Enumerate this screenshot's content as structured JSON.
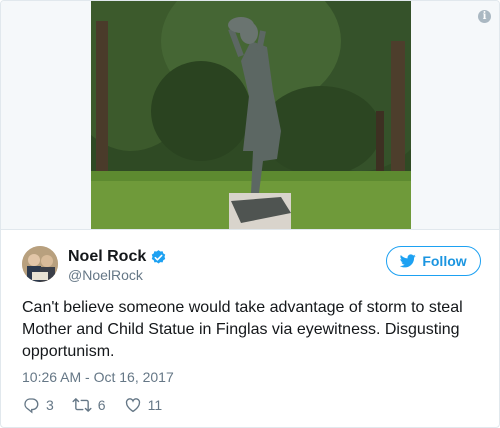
{
  "media": {
    "alt": "Mother and Child statue in a park",
    "info_icon": "info-icon"
  },
  "author": {
    "name": "Noel Rock",
    "handle": "@NoelRock",
    "verified": true,
    "avatar_icon": "avatar-photo"
  },
  "follow_button": {
    "label": "Follow",
    "icon": "twitter-bird-icon"
  },
  "tweet": {
    "text": "Can't believe someone would take advantage of storm to steal Mother and Child Statue in Finglas via eyewitness. Disgusting opportunism.",
    "timestamp": "10:26 AM - Oct 16, 2017"
  },
  "actions": {
    "replies": "3",
    "retweets": "6",
    "likes": "11"
  },
  "colors": {
    "accent": "#1da1f2",
    "text": "#14171a",
    "secondary": "#657786",
    "border": "#e1e8ed"
  }
}
